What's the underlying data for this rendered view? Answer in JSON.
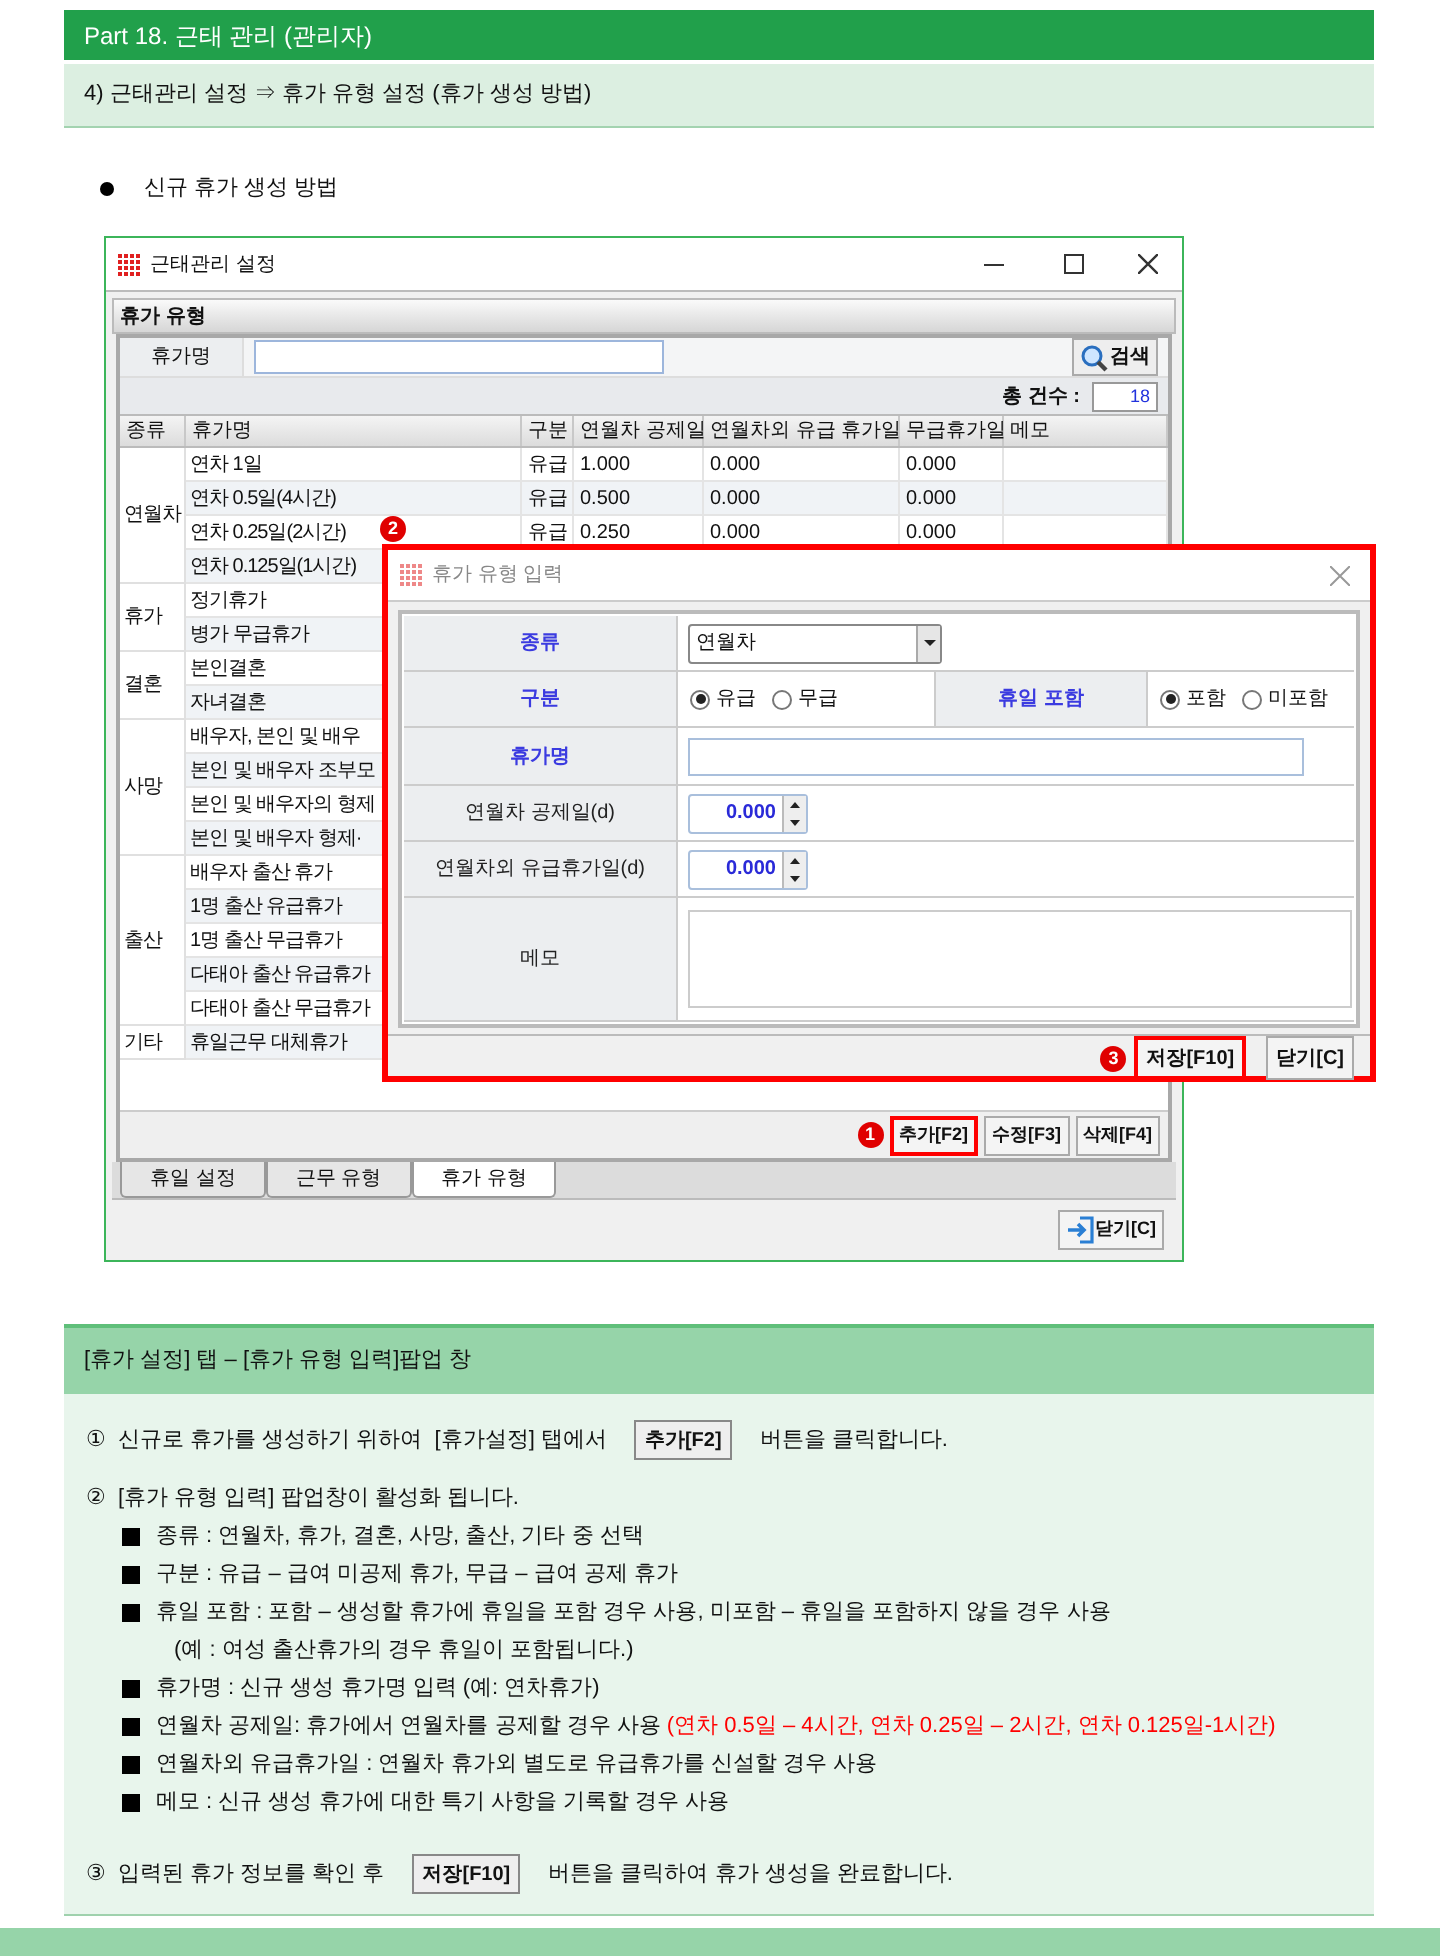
{
  "header": {
    "title": "Part 18. 근태 관리 (관리자)",
    "subtitle": "4) 근태관리 설정 ⇒ 휴가 유형 설정 (휴가 생성 방법)",
    "bullet": "신규 휴가 생성 방법"
  },
  "window": {
    "title": "근태관리 설정",
    "group_title": "휴가 유형",
    "search": {
      "label": "휴가명",
      "button": "검색"
    },
    "count": {
      "label": "총 건수 :",
      "value": "18"
    },
    "table": {
      "columns": [
        "종류",
        "휴가명",
        "구분",
        "연월차 공제일",
        "연월차외 유급 휴가일",
        "무급휴가일",
        "메모"
      ],
      "groups": [
        {
          "label": "연월차",
          "rows": [
            {
              "name": "연차 1일",
              "type": "유급",
              "annual_deduct": "1.000",
              "paid_days": "0.000",
              "unpaid_days": "0.000"
            },
            {
              "name": "연차 0.5일(4시간)",
              "type": "유급",
              "annual_deduct": "0.500",
              "paid_days": "0.000",
              "unpaid_days": "0.000"
            },
            {
              "name": "연차 0.25일(2시간)",
              "type": "유급",
              "annual_deduct": "0.250",
              "paid_days": "0.000",
              "unpaid_days": "0.000"
            },
            {
              "name": "연차 0.125일(1시간)"
            }
          ]
        },
        {
          "label": "휴가",
          "rows": [
            {
              "name": "정기휴가"
            },
            {
              "name": "병가 무급휴가"
            }
          ]
        },
        {
          "label": "결혼",
          "rows": [
            {
              "name": "본인결혼"
            },
            {
              "name": "자녀결혼"
            }
          ]
        },
        {
          "label": "사망",
          "rows": [
            {
              "name": "배우자, 본인 및 배우"
            },
            {
              "name": "본인 및 배우자 조부모"
            },
            {
              "name": "본인 및 배우자의 형제"
            },
            {
              "name": "본인 및 배우자 형제·"
            }
          ]
        },
        {
          "label": "출산",
          "rows": [
            {
              "name": "배우자 출산 휴가"
            },
            {
              "name": "1명 출산 유급휴가"
            },
            {
              "name": "1명 출산 무급휴가"
            },
            {
              "name": "다태아 출산 유급휴가"
            },
            {
              "name": "다태아 출산 무급휴가"
            }
          ]
        },
        {
          "label": "기타",
          "rows": [
            {
              "name": "휴일근무 대체휴가"
            }
          ]
        }
      ]
    },
    "actions": [
      {
        "label": "추가[F2]",
        "marker": "1"
      },
      {
        "label": "수정[F3]"
      },
      {
        "label": "삭제[F4]"
      }
    ],
    "tabs": [
      {
        "label": "휴일 설정",
        "selected": false
      },
      {
        "label": "근무 유형",
        "selected": false
      },
      {
        "label": "휴가 유형",
        "selected": true
      }
    ],
    "close_button": "닫기[C]"
  },
  "popup": {
    "marker": "2",
    "title": "휴가 유형 입력",
    "fields": [
      {
        "kind": "select",
        "label": "종류",
        "required": true,
        "value": "연월차"
      },
      {
        "kind": "radios",
        "label": "구분",
        "required": true,
        "options": [
          {
            "label": "유급",
            "selected": true
          },
          {
            "label": "무급",
            "selected": false
          }
        ],
        "side": {
          "label": "휴일 포함",
          "required": true,
          "options": [
            {
              "label": "포함",
              "selected": true
            },
            {
              "label": "미포함",
              "selected": false
            }
          ]
        }
      },
      {
        "kind": "text",
        "label": "휴가명",
        "required": true
      },
      {
        "kind": "spinner",
        "label": "연월차 공제일(d)",
        "required": false,
        "value": "0.000"
      },
      {
        "kind": "spinner",
        "label": "연월차외 유급휴가일(d)",
        "required": false,
        "value": "0.000"
      },
      {
        "kind": "textarea",
        "label": "메모",
        "required": false
      }
    ],
    "buttons": [
      {
        "label": "저장[F10]",
        "marker": "3"
      },
      {
        "label": "닫기[C]"
      }
    ]
  },
  "guide": {
    "title": "[휴가 설정] 탭 – [휴가 유형 입력]팝업 창",
    "steps": [
      {
        "num": "①",
        "text": "신규로 휴가를 생성하기 위하여  [휴가설정] 탭에서",
        "button": "추가[F2]",
        "after": "버튼을 클릭합니다."
      },
      {
        "num": "②",
        "text": "[휴가 유형 입력] 팝업창이 활성화 됩니다.",
        "items": [
          {
            "text": "종류 : 연월차, 휴가, 결혼, 사망, 출산, 기타 중 선택"
          },
          {
            "text": "구분 : 유급 – 급여 미공제 휴가, 무급 – 급여 공제 휴가"
          },
          {
            "text": "휴일 포함 : 포함 – 생성할 휴가에 휴일을 포함 경우 사용, 미포함 – 휴일을 포함하지 않을 경우 사용",
            "note": "(예 : 여성 출산휴가의 경우 휴일이 포함됩니다.)"
          },
          {
            "text": "휴가명 : 신규 생성 휴가명 입력 (예: 연차휴가)"
          },
          {
            "text": "연월차 공제일: 휴가에서 연월차를 공제할 경우 사용",
            "highlight": "(연차 0.5일 – 4시간, 연차 0.25일 – 2시간, 연차 0.125일-1시간)"
          },
          {
            "text": "연월차외 유급휴가일 : 연월차 휴가외 별도로 유급휴가를 신설할 경우 사용"
          },
          {
            "text": "메모 : 신규 생성 휴가에 대한 특기 사항을 기록할 경우 사용"
          }
        ]
      },
      {
        "num": "③",
        "text": "입력된 휴가 정보를 확인 후",
        "button": "저장[F10]",
        "after": "버튼을 클릭하여 휴가 생성을 완료합니다."
      }
    ]
  }
}
